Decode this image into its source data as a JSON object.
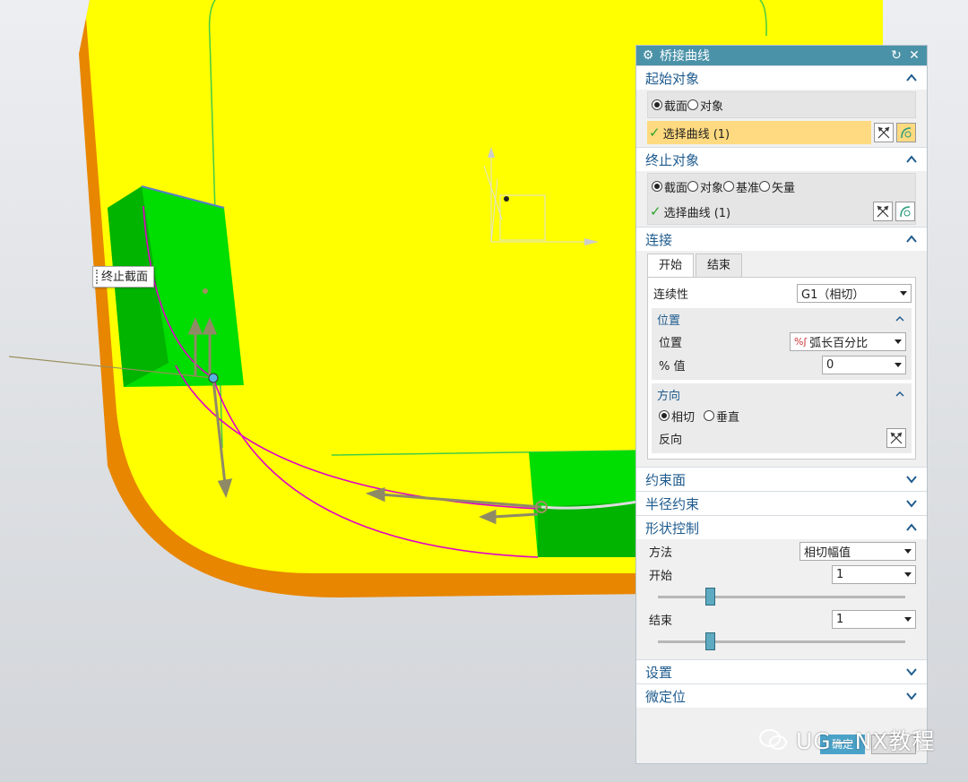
{
  "viewport": {
    "callout_label": "终止截面",
    "colors": {
      "face": "#ffff00",
      "rim": "#e88600",
      "green_face": "#00dd00",
      "dark_green": "#00b000",
      "curve": "#e000c8",
      "background": "#e1e3e6"
    }
  },
  "dialog": {
    "title": "桥接曲线",
    "title_icon": "gear-icon",
    "start_object": {
      "header": "起始对象",
      "radios": [
        {
          "label": "截面",
          "checked": true
        },
        {
          "label": "对象",
          "checked": false
        }
      ],
      "select_label": "选择曲线 (1)"
    },
    "end_object": {
      "header": "终止对象",
      "radios": [
        {
          "label": "截面",
          "checked": true
        },
        {
          "label": "对象",
          "checked": false
        },
        {
          "label": "基准",
          "checked": false
        },
        {
          "label": "矢量",
          "checked": false
        }
      ],
      "select_label": "选择曲线 (1)"
    },
    "connection": {
      "header": "连接",
      "tabs": [
        "开始",
        "结束"
      ],
      "continuity_label": "连续性",
      "continuity_value": "G1（相切）",
      "position_group": {
        "header": "位置",
        "position_label": "位置",
        "position_value": "弧长百分比",
        "percent_label": "% 值",
        "percent_value": "0"
      },
      "direction_group": {
        "header": "方向",
        "radios": [
          {
            "label": "相切",
            "checked": true
          },
          {
            "label": "垂直",
            "checked": false
          }
        ],
        "reverse_label": "反向"
      }
    },
    "constraint_face": {
      "header": "约束面"
    },
    "radius_constraint": {
      "header": "半径约束"
    },
    "shape_control": {
      "header": "形状控制",
      "method_label": "方法",
      "method_value": "相切幅值",
      "start_label": "开始",
      "start_value": "1",
      "start_slider": 0.2,
      "end_label": "结束",
      "end_value": "1",
      "end_slider": 0.2
    },
    "settings": {
      "header": "设置"
    },
    "fine_position": {
      "header": "微定位"
    },
    "ok_label": "确定"
  },
  "watermark": "UG—NX教程"
}
